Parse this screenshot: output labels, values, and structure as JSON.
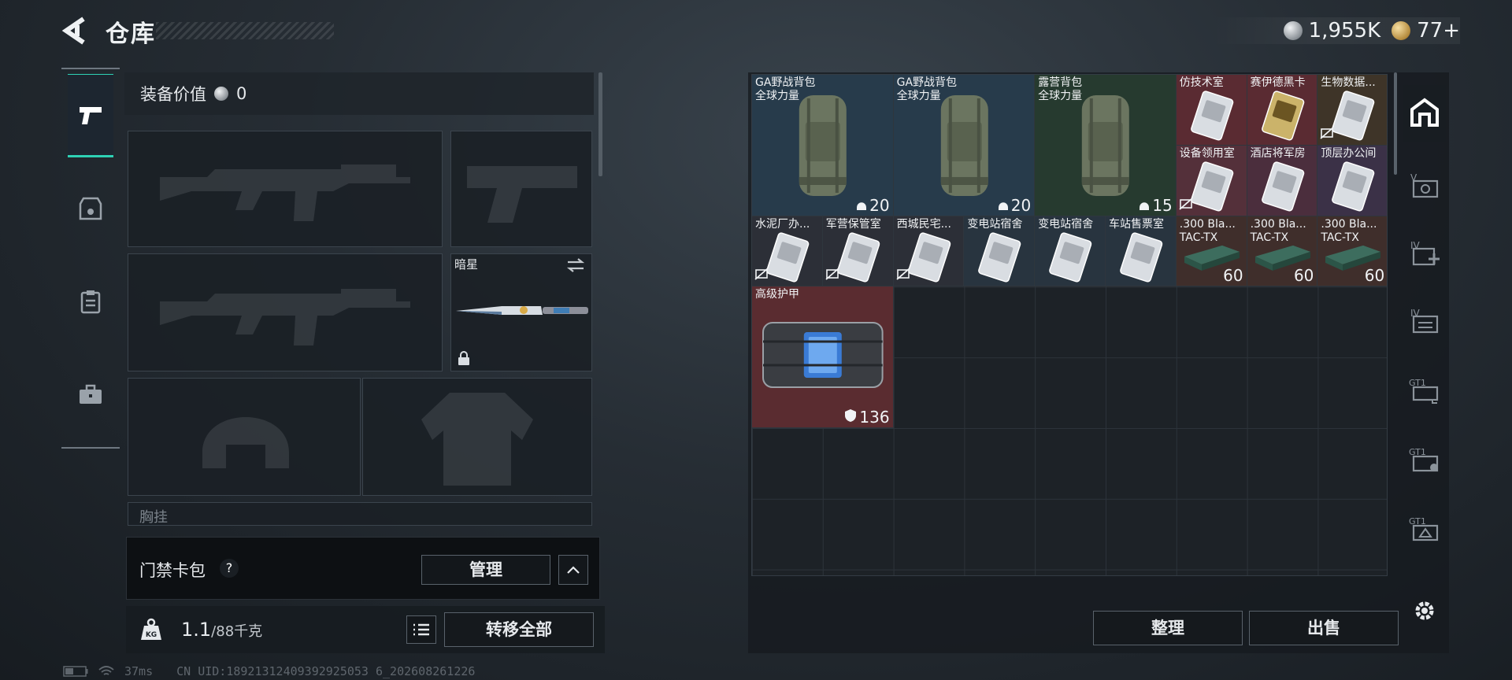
{
  "header": {
    "title": "仓库",
    "currencies": [
      {
        "icon": "silver-coin-icon",
        "value": "1,955K"
      },
      {
        "icon": "gold-coin-icon",
        "value": "77+"
      }
    ]
  },
  "left_nav": {
    "items": [
      {
        "name": "weapons",
        "icon": "pistol-icon",
        "active": true
      },
      {
        "name": "gear",
        "icon": "armor-icon",
        "active": false
      },
      {
        "name": "consumables",
        "icon": "clipboard-icon",
        "active": false
      },
      {
        "name": "cases",
        "icon": "briefcase-icon",
        "active": false
      }
    ]
  },
  "equipment": {
    "value_label": "装备价值",
    "value": "0",
    "melee_slot_name": "暗星",
    "chest_rig_label": "胸挂"
  },
  "card_pack": {
    "label": "门禁卡包",
    "help": "?",
    "manage_label": "管理"
  },
  "weight": {
    "current": "1.1",
    "capacity": "/88千克",
    "icon_label": "KG",
    "transfer_all_label": "转移全部"
  },
  "status": {
    "ping": "37ms",
    "uid": "CN UID:18921312409392925053 6_202608261226"
  },
  "stash": {
    "items": [
      {
        "id": "backpack-ga-1",
        "name": "GA野战背包",
        "sub": "全球力量",
        "count": "20",
        "count_icon": "helmet-icon",
        "bg": "#273b4b",
        "kind": "backpack"
      },
      {
        "id": "backpack-ga-2",
        "name": "GA野战背包",
        "sub": "全球力量",
        "count": "20",
        "count_icon": "helmet-icon",
        "bg": "#273b4b",
        "kind": "backpack"
      },
      {
        "id": "backpack-camp",
        "name": "露营背包",
        "sub": "全球力量",
        "count": "15",
        "count_icon": "helmet-icon",
        "bg": "#263a2f",
        "kind": "backpack"
      },
      {
        "id": "card-1",
        "name": "仿技术室",
        "bg": "#5a2b32",
        "kind": "card",
        "nontrade": false
      },
      {
        "id": "card-2",
        "name": "赛伊德黑卡",
        "bg": "#5a2b32",
        "kind": "card-gold",
        "nontrade": false
      },
      {
        "id": "card-3",
        "name": "生物数据...",
        "bg": "#3e3428",
        "kind": "card",
        "nontrade": true
      },
      {
        "id": "card-4",
        "name": "设备领用室",
        "bg": "#54303a",
        "kind": "card",
        "nontrade": true
      },
      {
        "id": "card-5",
        "name": "酒店将军房",
        "bg": "#4b2e3d",
        "kind": "card",
        "nontrade": false
      },
      {
        "id": "card-6",
        "name": "顶层办公间",
        "bg": "#3b3147",
        "kind": "card",
        "nontrade": false
      },
      {
        "id": "card-7",
        "name": "水泥厂办...",
        "bg": "#2c2f37",
        "kind": "card",
        "nontrade": true
      },
      {
        "id": "card-8",
        "name": "军营保管室",
        "bg": "#2c2f37",
        "kind": "card",
        "nontrade": true
      },
      {
        "id": "card-9",
        "name": "西城民宅...",
        "bg": "#2c2f37",
        "kind": "card",
        "nontrade": true
      },
      {
        "id": "card-10",
        "name": "变电站宿舍",
        "bg": "#28343f",
        "kind": "card",
        "nontrade": false
      },
      {
        "id": "card-11",
        "name": "变电站宿舍",
        "bg": "#28343f",
        "kind": "card",
        "nontrade": false
      },
      {
        "id": "card-12",
        "name": "车站售票室",
        "bg": "#28343f",
        "kind": "card",
        "nontrade": false
      },
      {
        "id": "ammo-1",
        "name": ".300 Bla...",
        "sub": "TAC-TX",
        "count": "60",
        "bg": "#3f2e2b",
        "kind": "ammo"
      },
      {
        "id": "ammo-2",
        "name": ".300 Bla...",
        "sub": "TAC-TX",
        "count": "60",
        "bg": "#3f2e2b",
        "kind": "ammo"
      },
      {
        "id": "ammo-3",
        "name": ".300 Bla...",
        "sub": "TAC-TX",
        "count": "60",
        "bg": "#3f2e2b",
        "kind": "ammo"
      },
      {
        "id": "armor-advanced",
        "name": "高级护甲",
        "count": "136",
        "count_icon": "shield-icon",
        "bg": "#5a2c30",
        "kind": "armor"
      }
    ],
    "sort_label": "整理",
    "sell_label": "出售"
  },
  "right_rail": {
    "items": [
      {
        "name": "stash-home",
        "icon": "stash-home-icon",
        "active": true
      },
      {
        "name": "tab-v",
        "icon": "tab-v-icon"
      },
      {
        "name": "tab-iv-add",
        "icon": "tab-iv-add-icon"
      },
      {
        "name": "tab-iv",
        "icon": "tab-iv-icon"
      },
      {
        "name": "tab-gt1",
        "icon": "tab-gt1-icon"
      },
      {
        "name": "tab-gt1-b",
        "icon": "tab-gt1-b-icon"
      },
      {
        "name": "tab-gt1-c",
        "icon": "tab-gt1-c-icon"
      },
      {
        "name": "settings",
        "icon": "gear-icon"
      }
    ]
  },
  "colors": {
    "accent": "#2ed1b4",
    "panel": "#1d2227",
    "border": "#59626b"
  }
}
